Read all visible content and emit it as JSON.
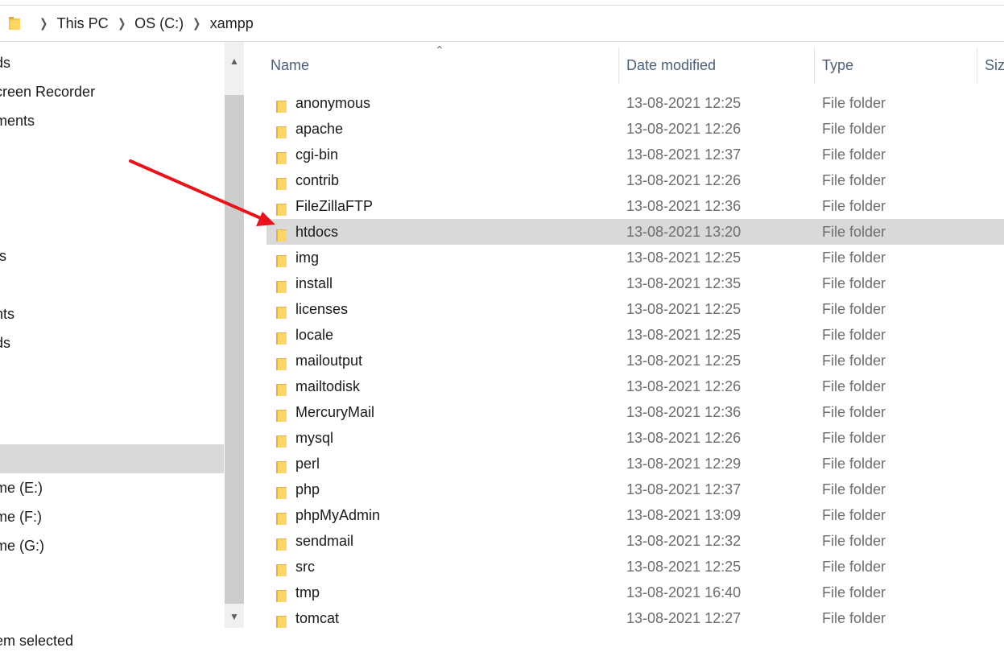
{
  "breadcrumb": [
    "This PC",
    "OS (C:)",
    "xampp"
  ],
  "nav_items": [
    {
      "label": "ds",
      "top": 0
    },
    {
      "label": "creen Recorder"
    },
    {
      "label": "ments"
    },
    {
      "label": "ts"
    },
    {
      "label": "nts"
    },
    {
      "label": "ds"
    },
    {
      "label": ""
    },
    {
      "label": "me (E:)"
    },
    {
      "label": "me (F:)"
    },
    {
      "label": "me (G:)"
    }
  ],
  "columns": {
    "name": "Name",
    "date": "Date modified",
    "type": "Type",
    "size": "Siz"
  },
  "files": [
    {
      "name": "anonymous",
      "date": "13-08-2021 12:25",
      "type": "File folder"
    },
    {
      "name": "apache",
      "date": "13-08-2021 12:26",
      "type": "File folder"
    },
    {
      "name": "cgi-bin",
      "date": "13-08-2021 12:37",
      "type": "File folder"
    },
    {
      "name": "contrib",
      "date": "13-08-2021 12:26",
      "type": "File folder"
    },
    {
      "name": "FileZillaFTP",
      "date": "13-08-2021 12:36",
      "type": "File folder"
    },
    {
      "name": "htdocs",
      "date": "13-08-2021 13:20",
      "type": "File folder"
    },
    {
      "name": "img",
      "date": "13-08-2021 12:25",
      "type": "File folder"
    },
    {
      "name": "install",
      "date": "13-08-2021 12:35",
      "type": "File folder"
    },
    {
      "name": "licenses",
      "date": "13-08-2021 12:25",
      "type": "File folder"
    },
    {
      "name": "locale",
      "date": "13-08-2021 12:25",
      "type": "File folder"
    },
    {
      "name": "mailoutput",
      "date": "13-08-2021 12:25",
      "type": "File folder"
    },
    {
      "name": "mailtodisk",
      "date": "13-08-2021 12:26",
      "type": "File folder"
    },
    {
      "name": "MercuryMail",
      "date": "13-08-2021 12:36",
      "type": "File folder"
    },
    {
      "name": "mysql",
      "date": "13-08-2021 12:26",
      "type": "File folder"
    },
    {
      "name": "perl",
      "date": "13-08-2021 12:29",
      "type": "File folder"
    },
    {
      "name": "php",
      "date": "13-08-2021 12:37",
      "type": "File folder"
    },
    {
      "name": "phpMyAdmin",
      "date": "13-08-2021 13:09",
      "type": "File folder"
    },
    {
      "name": "sendmail",
      "date": "13-08-2021 12:32",
      "type": "File folder"
    },
    {
      "name": "src",
      "date": "13-08-2021 12:25",
      "type": "File folder"
    },
    {
      "name": "tmp",
      "date": "13-08-2021 16:40",
      "type": "File folder"
    },
    {
      "name": "tomcat",
      "date": "13-08-2021 12:27",
      "type": "File folder"
    }
  ],
  "selected_file": "htdocs",
  "status": "em selected",
  "colors": {
    "accent_arrow": "#e8141b",
    "folder": "#f6c64a",
    "selection": "#d9d9d9"
  }
}
